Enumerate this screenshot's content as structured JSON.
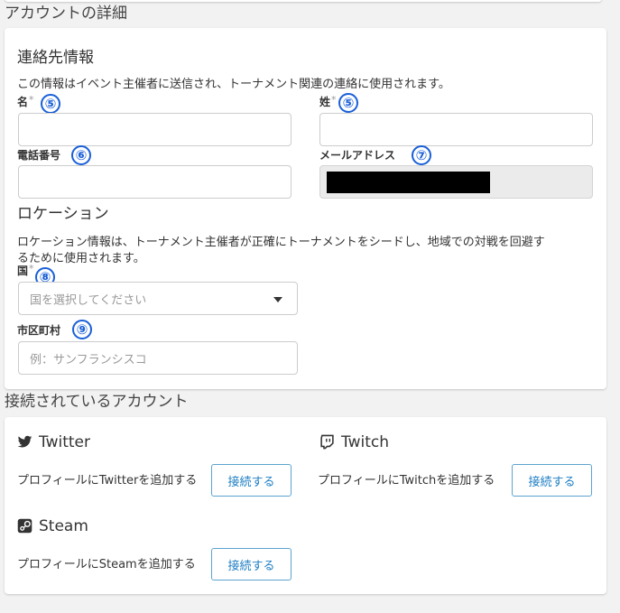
{
  "account": {
    "section_title": "アカウントの詳細",
    "contact": {
      "title": "連絡先情報",
      "description": "この情報はイベント主催者に送信され、トーナメント関連の連絡に使用されます。",
      "first_name": {
        "label": "名",
        "required": "*",
        "marker": "⑤",
        "value": ""
      },
      "last_name": {
        "label": "姓",
        "required": "*",
        "marker": "⑤",
        "value": ""
      },
      "phone": {
        "label": "電話番号",
        "marker": "⑥",
        "value": ""
      },
      "email": {
        "label": "メールアドレス",
        "marker": "⑦"
      }
    },
    "location": {
      "title": "ロケーション",
      "description_line1": "ロケーション情報は、トーナメント主催者が正確にトーナメントをシードし、地域での対戦を回避す",
      "description_line2": "るために使用されます。",
      "country": {
        "label": "国",
        "required": "*",
        "marker": "⑧",
        "placeholder": "国を選択してください"
      },
      "city": {
        "label": "市区町村",
        "marker": "⑨",
        "placeholder": "例：サンフランシスコ"
      }
    }
  },
  "connected": {
    "section_title": "接続されているアカウント",
    "twitter": {
      "name": "Twitter",
      "icon": "twitter-bird-icon",
      "description": "プロフィールにTwitterを追加する",
      "button": "接続する"
    },
    "twitch": {
      "name": "Twitch",
      "icon": "twitch-glitch-icon",
      "description": "プロフィールにTwitchを追加する",
      "button": "接続する"
    },
    "steam": {
      "name": "Steam",
      "icon": "steam-logo-icon",
      "description": "プロフィールにSteamを追加する",
      "button": "接続する"
    }
  },
  "colors": {
    "accent": "#1d7ec4",
    "marker": "#1a5fd8"
  }
}
